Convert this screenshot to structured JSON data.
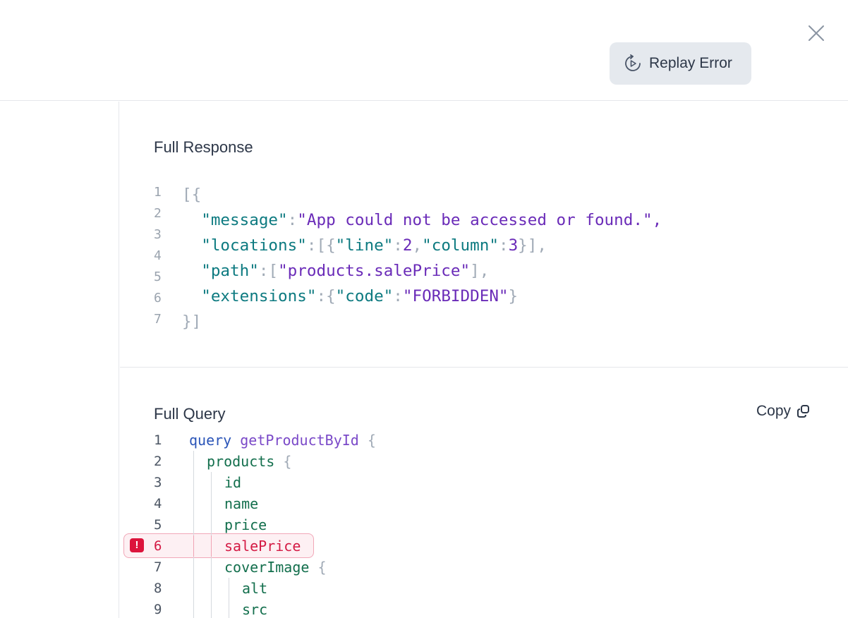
{
  "header": {
    "replay_label": "Replay Error",
    "replay_icon": "replay-icon",
    "close_icon": "close-icon"
  },
  "response": {
    "title": "Full Response",
    "line_numbers": [
      "1",
      "2",
      "3",
      "4",
      "5",
      "6",
      "7"
    ],
    "lines": [
      [
        {
          "t": "[{",
          "c": "p"
        }
      ],
      [
        {
          "t": "  ",
          "c": "p"
        },
        {
          "t": "\"message\"",
          "c": "k"
        },
        {
          "t": ":",
          "c": "p"
        },
        {
          "t": "\"App could not be accessed or found.\"",
          "c": "s"
        },
        {
          "t": ",",
          "c": "s"
        }
      ],
      [
        {
          "t": "  ",
          "c": "p"
        },
        {
          "t": "\"locations\"",
          "c": "k"
        },
        {
          "t": ":[{",
          "c": "p"
        },
        {
          "t": "\"line\"",
          "c": "k"
        },
        {
          "t": ":",
          "c": "p"
        },
        {
          "t": "2",
          "c": "n"
        },
        {
          "t": ",",
          "c": "p"
        },
        {
          "t": "\"column\"",
          "c": "k"
        },
        {
          "t": ":",
          "c": "p"
        },
        {
          "t": "3",
          "c": "n"
        },
        {
          "t": "}],",
          "c": "p"
        }
      ],
      [
        {
          "t": "  ",
          "c": "p"
        },
        {
          "t": "\"path\"",
          "c": "k"
        },
        {
          "t": ":[",
          "c": "p"
        },
        {
          "t": "\"products.salePrice\"",
          "c": "s"
        },
        {
          "t": "],",
          "c": "p"
        }
      ],
      [
        {
          "t": "  ",
          "c": "p"
        },
        {
          "t": "\"extensions\"",
          "c": "k"
        },
        {
          "t": ":{",
          "c": "p"
        },
        {
          "t": "\"code\"",
          "c": "k"
        },
        {
          "t": ":",
          "c": "p"
        },
        {
          "t": "\"FORBIDDEN\"",
          "c": "s"
        },
        {
          "t": "}",
          "c": "p"
        }
      ],
      [
        {
          "t": "}]",
          "c": "p"
        }
      ]
    ]
  },
  "query": {
    "title": "Full Query",
    "copy_label": "Copy",
    "copy_icon": "copy-icon",
    "error_icon": "error-icon",
    "error_badge": "!",
    "colors": {
      "error": "#dc143c",
      "keyword": "#2b55b8",
      "field": "#136f4d",
      "string": "#6a2bb8"
    },
    "lines": [
      {
        "num": "1",
        "indent": 0,
        "parts": [
          {
            "t": "query",
            "c": "q-kw"
          },
          {
            "t": " getProductById",
            "c": "q-fn"
          },
          {
            "t": " {",
            "c": "q-br"
          }
        ]
      },
      {
        "num": "2",
        "indent": 1,
        "parts": [
          {
            "t": "products",
            "c": "q-f"
          },
          {
            "t": " {",
            "c": "q-br"
          }
        ]
      },
      {
        "num": "3",
        "indent": 2,
        "parts": [
          {
            "t": "id",
            "c": "q-f"
          }
        ]
      },
      {
        "num": "4",
        "indent": 2,
        "parts": [
          {
            "t": "name",
            "c": "q-f"
          }
        ]
      },
      {
        "num": "5",
        "indent": 2,
        "parts": [
          {
            "t": "price",
            "c": "q-f"
          }
        ]
      },
      {
        "num": "6",
        "indent": 2,
        "error": true,
        "parts": [
          {
            "t": "salePrice",
            "c": "q-f err-field"
          }
        ]
      },
      {
        "num": "7",
        "indent": 2,
        "parts": [
          {
            "t": "coverImage",
            "c": "q-f"
          },
          {
            "t": " {",
            "c": "q-br"
          }
        ]
      },
      {
        "num": "8",
        "indent": 3,
        "parts": [
          {
            "t": "alt",
            "c": "q-f"
          }
        ]
      },
      {
        "num": "9",
        "indent": 3,
        "parts": [
          {
            "t": "src",
            "c": "q-f"
          }
        ]
      }
    ]
  }
}
